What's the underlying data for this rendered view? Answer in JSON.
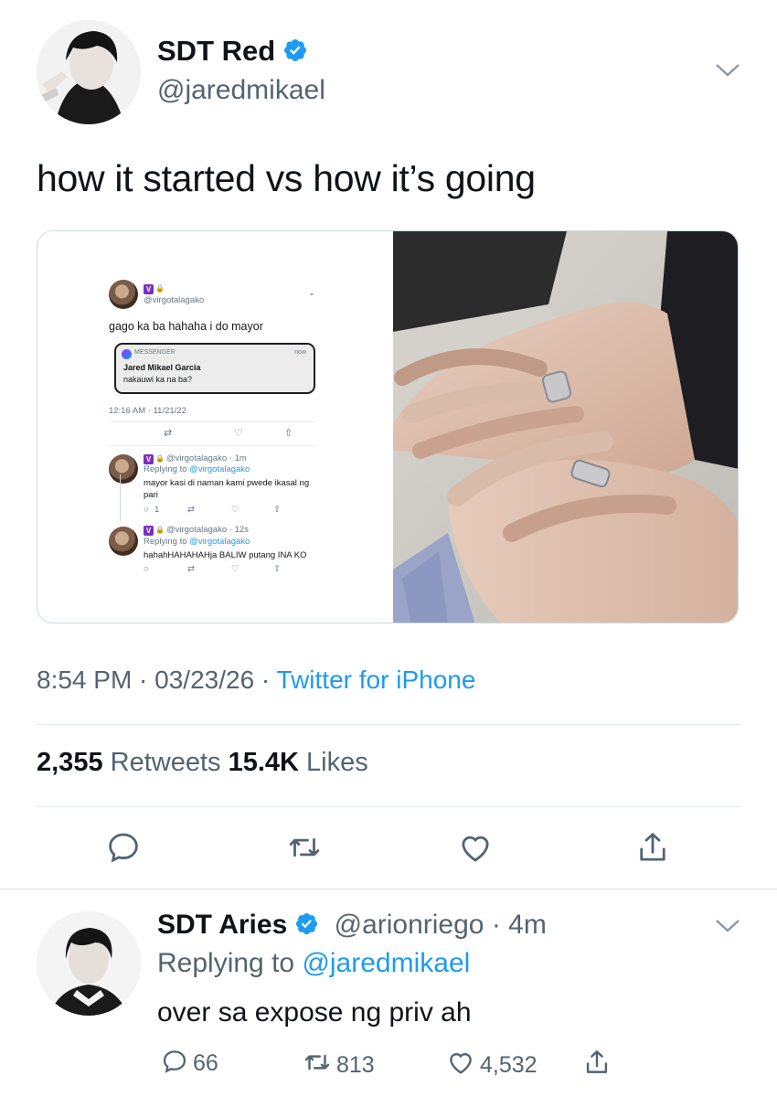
{
  "main_tweet": {
    "display_name": "SDT Red",
    "handle": "@jaredmikael",
    "text": "how it started vs how it’s going",
    "timestamp": "8:54 PM · 03/23/26 · ",
    "source": "Twitter for iPhone",
    "retweets_count": "2,355",
    "retweets_label": " Retweets ",
    "likes_count": "15.4K",
    "likes_label": " Likes"
  },
  "embedded": {
    "handle": "@virgotalagako",
    "text": "gago ka ba hahaha i do mayor",
    "notification": {
      "app": "MESSENGER",
      "time": "now",
      "sender": "Jared Mikael Garcia",
      "message": "nakauwi ka na ba?"
    },
    "date": "12:16 AM · 11/21/22",
    "reply1": {
      "handle": "@virgotalagako · 1m",
      "replying_prefix": "Replying to ",
      "replying_to": "@virgotalagako",
      "text_line1": "mayor kasi di naman kami pwede ikasal ng",
      "text_line2": "pari",
      "reply_count": "1"
    },
    "reply2": {
      "handle": "@virgotalagako · 12s",
      "replying_prefix": "Replying to ",
      "replying_to": "@virgotalagako",
      "text": "hahahHAHAHAHja BALIW putang INA KO"
    }
  },
  "reply": {
    "display_name": "SDT Aries",
    "handle": "@arionriego",
    "time": " · 4m",
    "replying_prefix": "Replying to ",
    "replying_to": "@jaredmikael",
    "text": "over sa expose ng priv ah",
    "reply_count": "66",
    "retweet_count": "813",
    "like_count": "4,532"
  },
  "colors": {
    "accent": "#1d9bf0",
    "muted": "#536471",
    "text": "#0f1419",
    "divider": "#e1e8ed"
  },
  "icons": [
    "verified-badge-icon",
    "chevron-down-icon",
    "reply-icon",
    "retweet-icon",
    "like-icon",
    "share-icon"
  ]
}
